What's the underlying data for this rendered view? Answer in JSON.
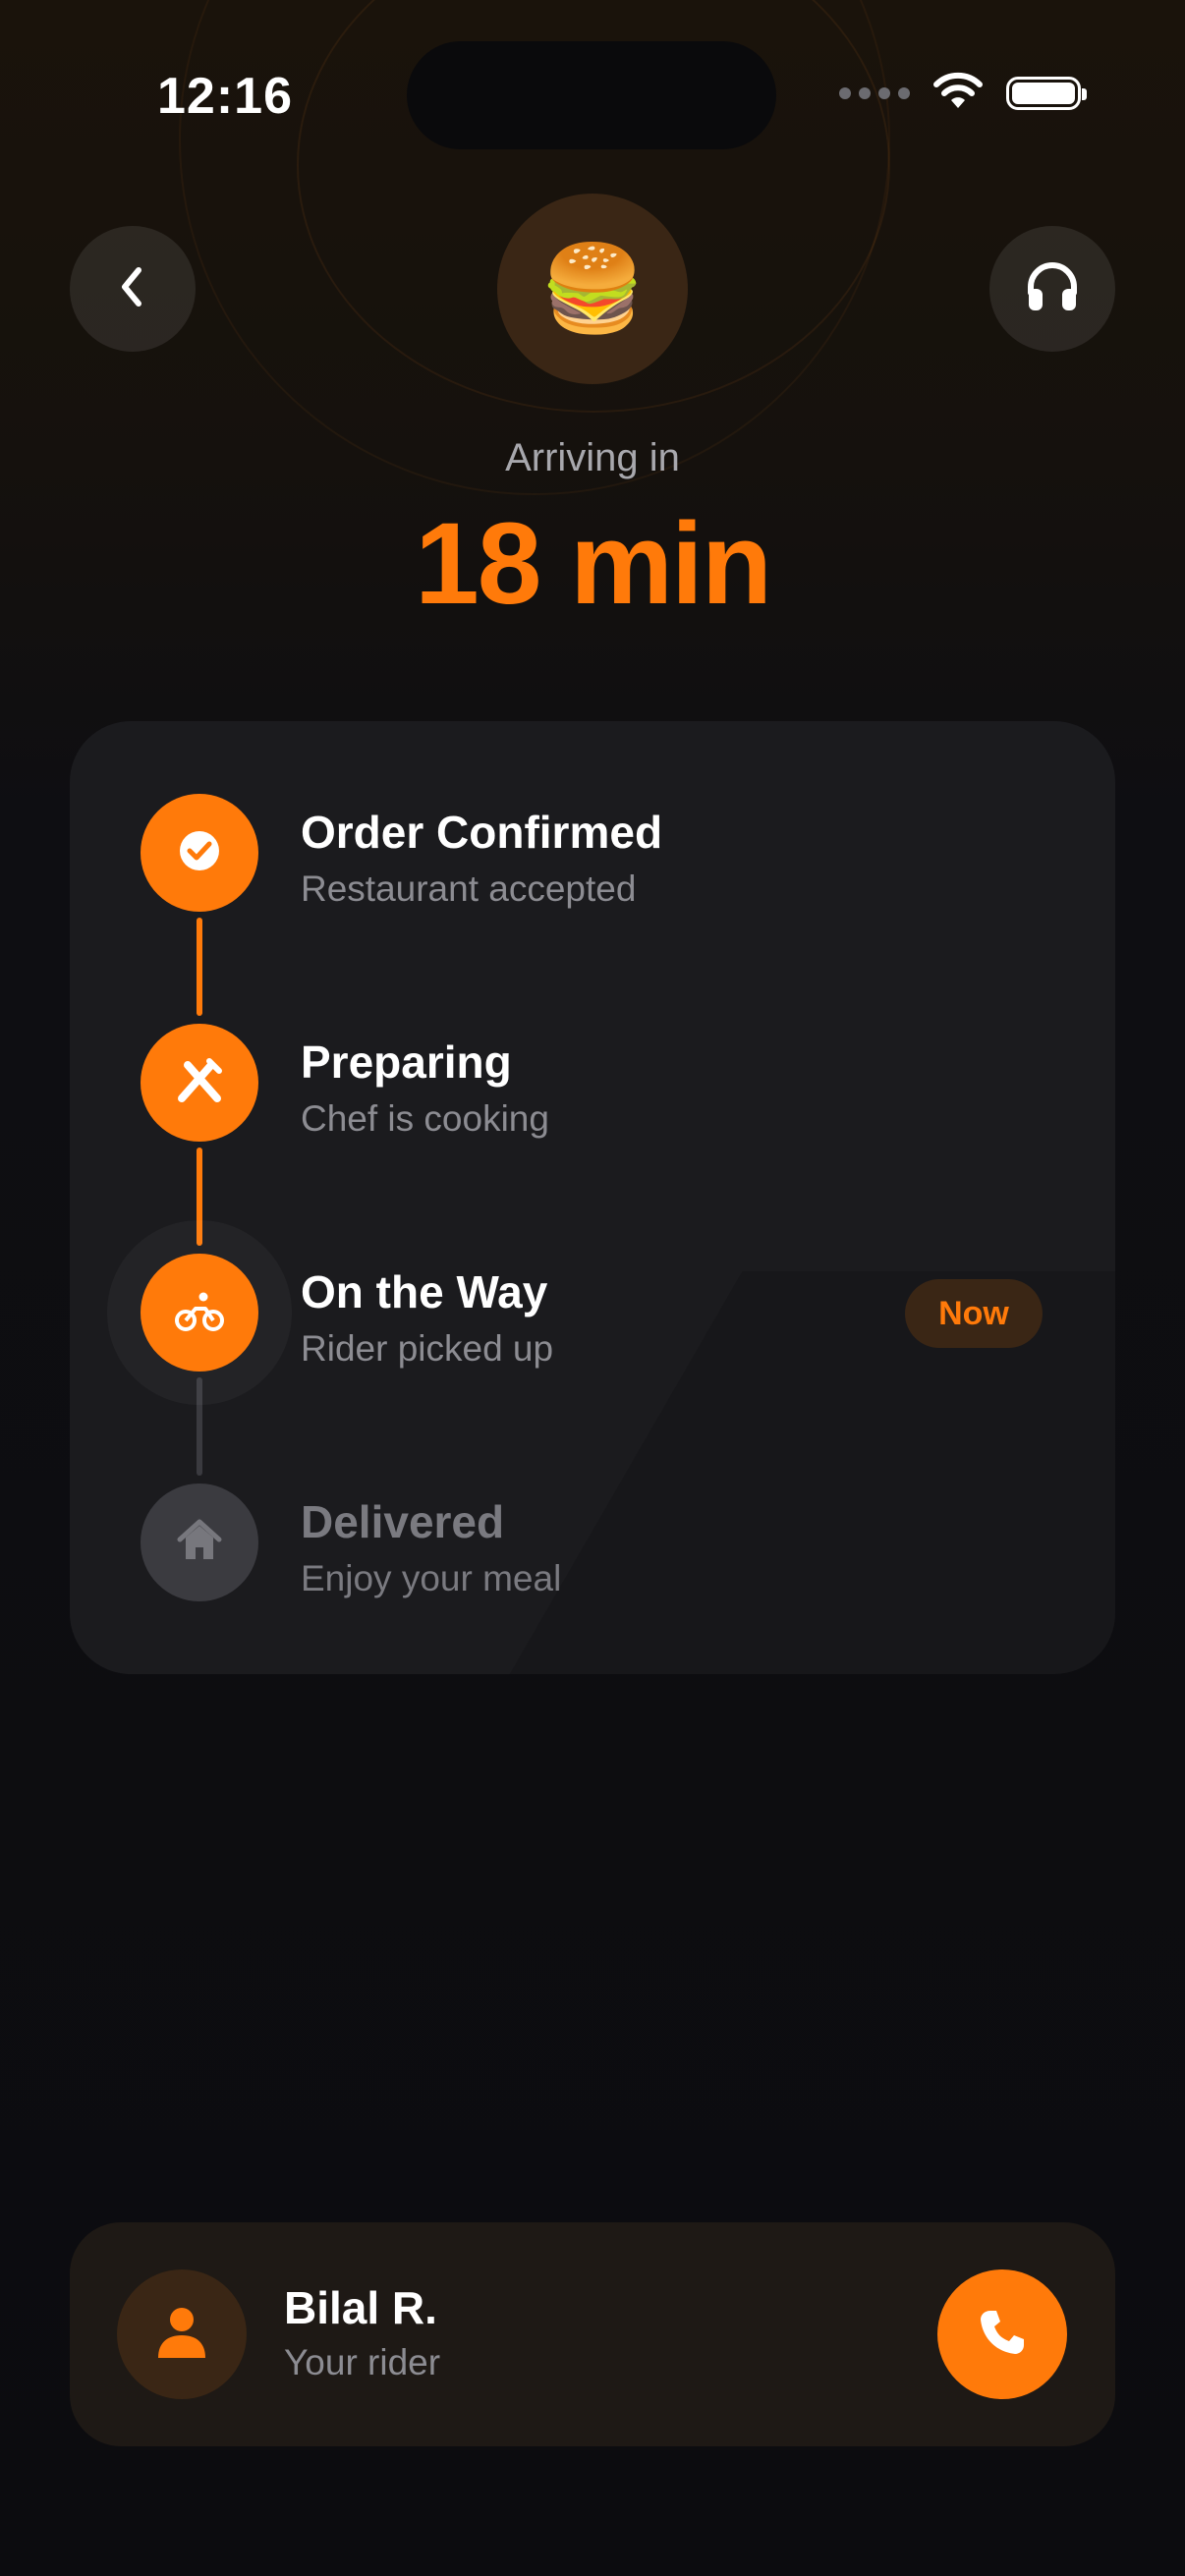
{
  "status_bar": {
    "time": "12:16"
  },
  "header": {
    "food_emoji": "🍔",
    "back_icon": "chevron-left-icon",
    "support_icon": "headphones-icon",
    "arriving_label": "Arriving in",
    "eta": "18 min"
  },
  "steps": [
    {
      "title": "Order Confirmed",
      "subtitle": "Restaurant accepted",
      "icon": "check-circle-icon",
      "state": "done"
    },
    {
      "title": "Preparing",
      "subtitle": "Chef is cooking",
      "icon": "fork-knife-icon",
      "state": "done"
    },
    {
      "title": "On the Way",
      "subtitle": "Rider picked up",
      "icon": "bicycle-icon",
      "state": "current",
      "badge": "Now"
    },
    {
      "title": "Delivered",
      "subtitle": "Enjoy your meal",
      "icon": "house-icon",
      "state": "pending"
    }
  ],
  "rider": {
    "name": "Bilal R.",
    "role": "Your rider",
    "avatar_icon": "person-icon",
    "call_icon": "phone-icon"
  },
  "colors": {
    "accent": "#ff7a0a",
    "card": "#1b1b1e",
    "background": "#0c0c0f",
    "muted_text": "#8c8c92",
    "pending": "#3b3b40"
  }
}
